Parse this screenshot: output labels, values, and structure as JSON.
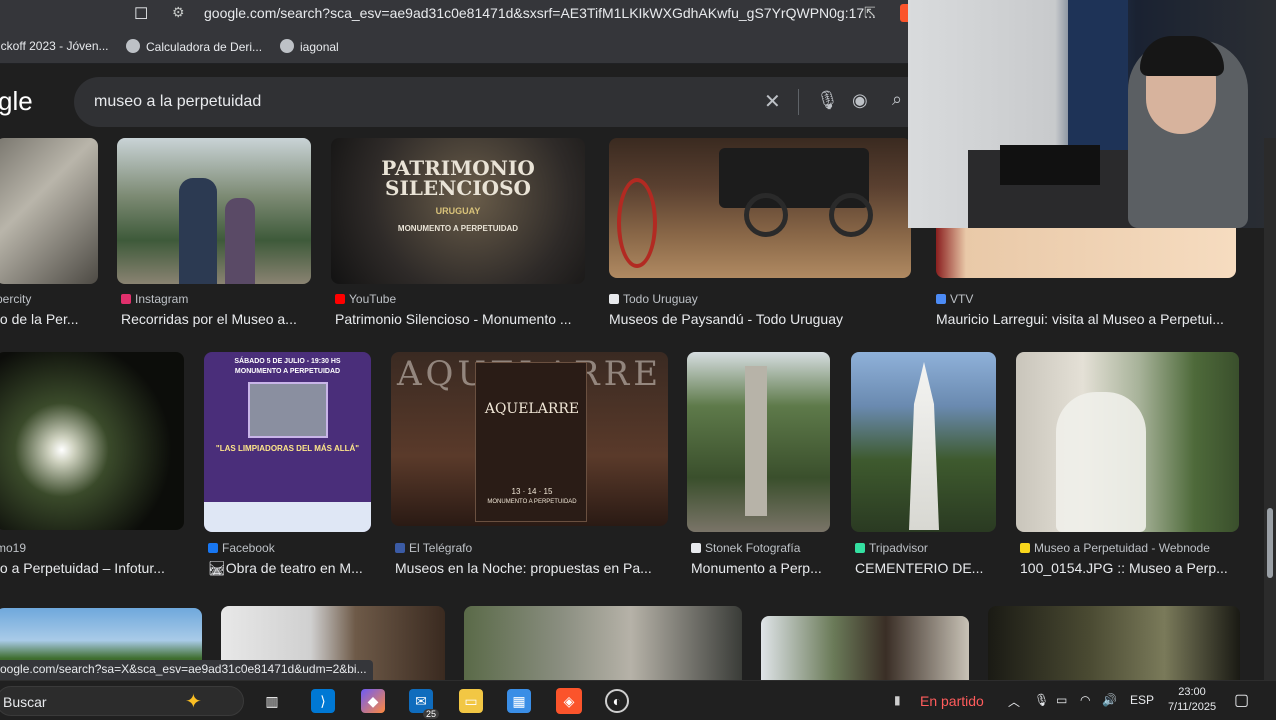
{
  "browser": {
    "url": "google.com/search?sca_esv=ae9ad31c0e81471d&sxsrf=AE3TifM1LKIkWXGdhAKwfu_gS7YrQWPN0g:17...",
    "bookmarks": [
      "ickoff 2023 - Jóven...",
      "Calculadora de Deri...",
      "iagonal"
    ]
  },
  "google": {
    "logo": "gle",
    "query": "museo a la perpetuidad"
  },
  "results": [
    {
      "source": "percity",
      "title": "to de la Per...",
      "fav": "#9aa0a6"
    },
    {
      "source": "Instagram",
      "title": "Recorridas por el Museo a...",
      "fav": "#e1306c"
    },
    {
      "source": "YouTube",
      "title": "Patrimonio Silencioso - Monumento ...",
      "fav": "#ff0000",
      "overlay": [
        "PATRIMONIO",
        "SILENCIOSO",
        "URUGUAY",
        "MONUMENTO A PERPETUIDAD"
      ]
    },
    {
      "source": "Todo Uruguay",
      "title": "Museos de Paysandú - Todo Uruguay",
      "fav": "#e8eaed"
    },
    {
      "source": "VTV",
      "title": "Mauricio Larregui: visita al Museo a Perpetui...",
      "fav": "#4c8bf5"
    },
    {
      "source": "mo19",
      "title": "to a Perpetuidad – Infotur...",
      "fav": "#9aa0a6"
    },
    {
      "source": "Facebook",
      "title": "🛤Obra de teatro en M...",
      "fav": "#1877f2",
      "overlay": [
        "SÁBADO 5 DE JULIO - 19:30 HS",
        "MONUMENTO A PERPETUIDAD",
        "\"LAS LIMPIADORAS DEL MÁS ALLÁ\""
      ]
    },
    {
      "source": "El Telégrafo",
      "title": "Museos en la Noche: propuestas en Pa...",
      "fav": "#3b5ba5",
      "overlay": [
        "AQUELARRE",
        "13 · 14 · 15",
        "MONUMENTO A PERPETUIDAD"
      ]
    },
    {
      "source": "Stonek Fotografía",
      "title": "Monumento a Perp...",
      "fav": "#e8eaed"
    },
    {
      "source": "Tripadvisor",
      "title": "CEMENTERIO DE...",
      "fav": "#34e0a1"
    },
    {
      "source": "Museo a Perpetuidad - Webnode",
      "title": "100_0154.JPG :: Museo a Perp...",
      "fav": "#f9d71c"
    }
  ],
  "status_link": "oogle.com/search?sa=X&sca_esv=ae9ad31c0e81471d&udm=2&bi...",
  "taskbar": {
    "search_label": "Buscar",
    "mail_badge": "25",
    "status": "En partido",
    "lang": "ESP",
    "time": "23:00",
    "date": "7/11/2025"
  }
}
